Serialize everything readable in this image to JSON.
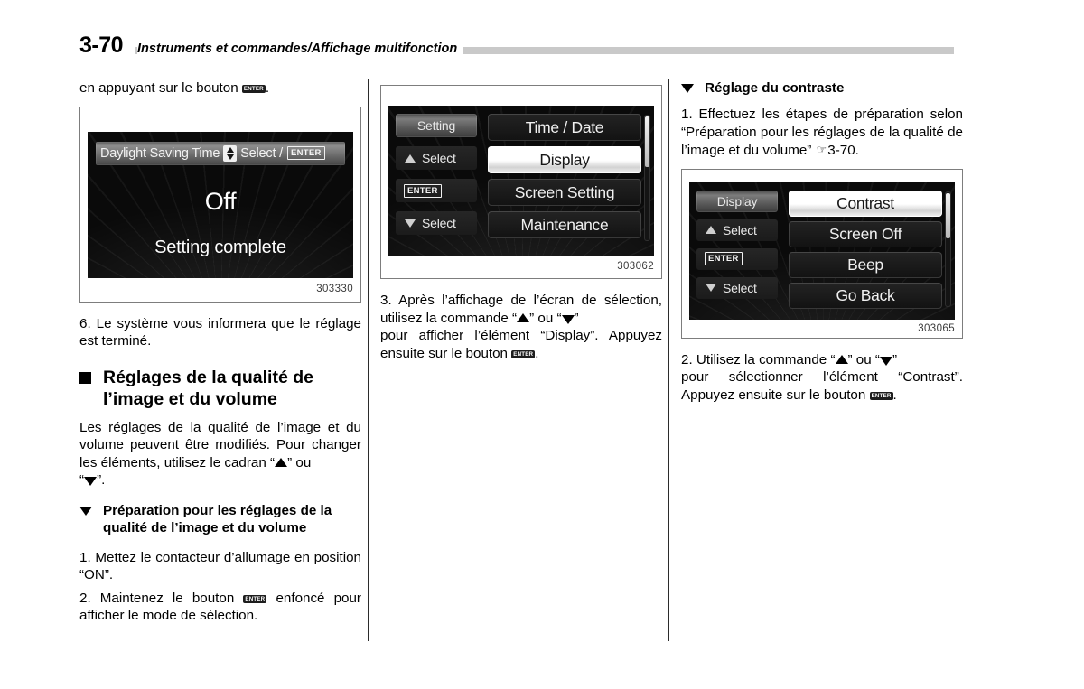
{
  "header": {
    "page_number": "3-70",
    "title": "Instruments et commandes/Affichage multifonction"
  },
  "column_1": {
    "intro_text_before": "en appuyant sur le bouton",
    "intro_text_after": ".",
    "enter_button_label": "ENTER",
    "figure": {
      "caption_number": "303330",
      "screen": {
        "header_label": "Daylight Saving Time",
        "header_select": "Select /",
        "header_enter": "ENTER",
        "value": "Off",
        "status": "Setting complete"
      }
    },
    "step_6": "6. Le système vous informera que le réglage est terminé.",
    "section_heading": "Réglages de la qualité de l’image et du volume",
    "paragraph_1a": "Les réglages de la qualité de l’image et du volume peuvent être modifiés. Pour changer les éléments, utilisez le cadran “",
    "paragraph_1b": "” ou",
    "paragraph_1c": "“",
    "paragraph_1d": "”.",
    "sub_heading": "Préparation pour les réglages de la qualité de l’image et du volume",
    "step_1": "1. Mettez le contacteur d’allumage en position “ON”.",
    "step_2a": "2. Maintenez le bouton",
    "step_2b": "enfoncé pour afficher le mode de sélection."
  },
  "column_2": {
    "figure": {
      "caption_number": "303062",
      "screen": {
        "left_title": "Setting",
        "left_select_up": "Select",
        "left_enter": "ENTER",
        "left_select_down": "Select",
        "items": [
          {
            "label": "Time / Date",
            "selected": false
          },
          {
            "label": "Display",
            "selected": true
          },
          {
            "label": "Screen Setting",
            "selected": false
          },
          {
            "label": "Maintenance",
            "selected": false
          }
        ]
      }
    },
    "step_3a": "3. Après l’affichage de l’écran de sélection, utilisez la commande “",
    "step_3b": "” ou “",
    "step_3c": "”",
    "step_3d": "pour afficher l’élément “Display”. Appuyez ensuite sur le bouton",
    "step_3e": "."
  },
  "column_3": {
    "sub_heading": "Réglage du contraste",
    "step_1a": "1. Effectuez les étapes de préparation selon “Préparation pour les réglages de la qualité de l’image et du volume”",
    "step_1_ref_icon": "☞",
    "step_1_ref": "3-70.",
    "figure": {
      "caption_number": "303065",
      "screen": {
        "left_title": "Display",
        "left_select_up": "Select",
        "left_enter": "ENTER",
        "left_select_down": "Select",
        "items": [
          {
            "label": "Contrast",
            "selected": true
          },
          {
            "label": "Screen Off",
            "selected": false
          },
          {
            "label": "Beep",
            "selected": false
          },
          {
            "label": "Go Back",
            "selected": false
          }
        ]
      }
    },
    "step_2a": "2. Utilisez la commande “",
    "step_2b": "” ou “",
    "step_2c": "”",
    "step_2d": "pour sélectionner l’élément “Contrast”. Appuyez ensuite sur le bouton",
    "step_2e": "."
  },
  "colors": {
    "page_background": "#ffffff",
    "text": "#000000",
    "header_rule": "#c9c9c9",
    "figure_border": "#7d7d7d",
    "lcd_background": "#0a0a0a",
    "caption_text": "#3a3a3a"
  }
}
